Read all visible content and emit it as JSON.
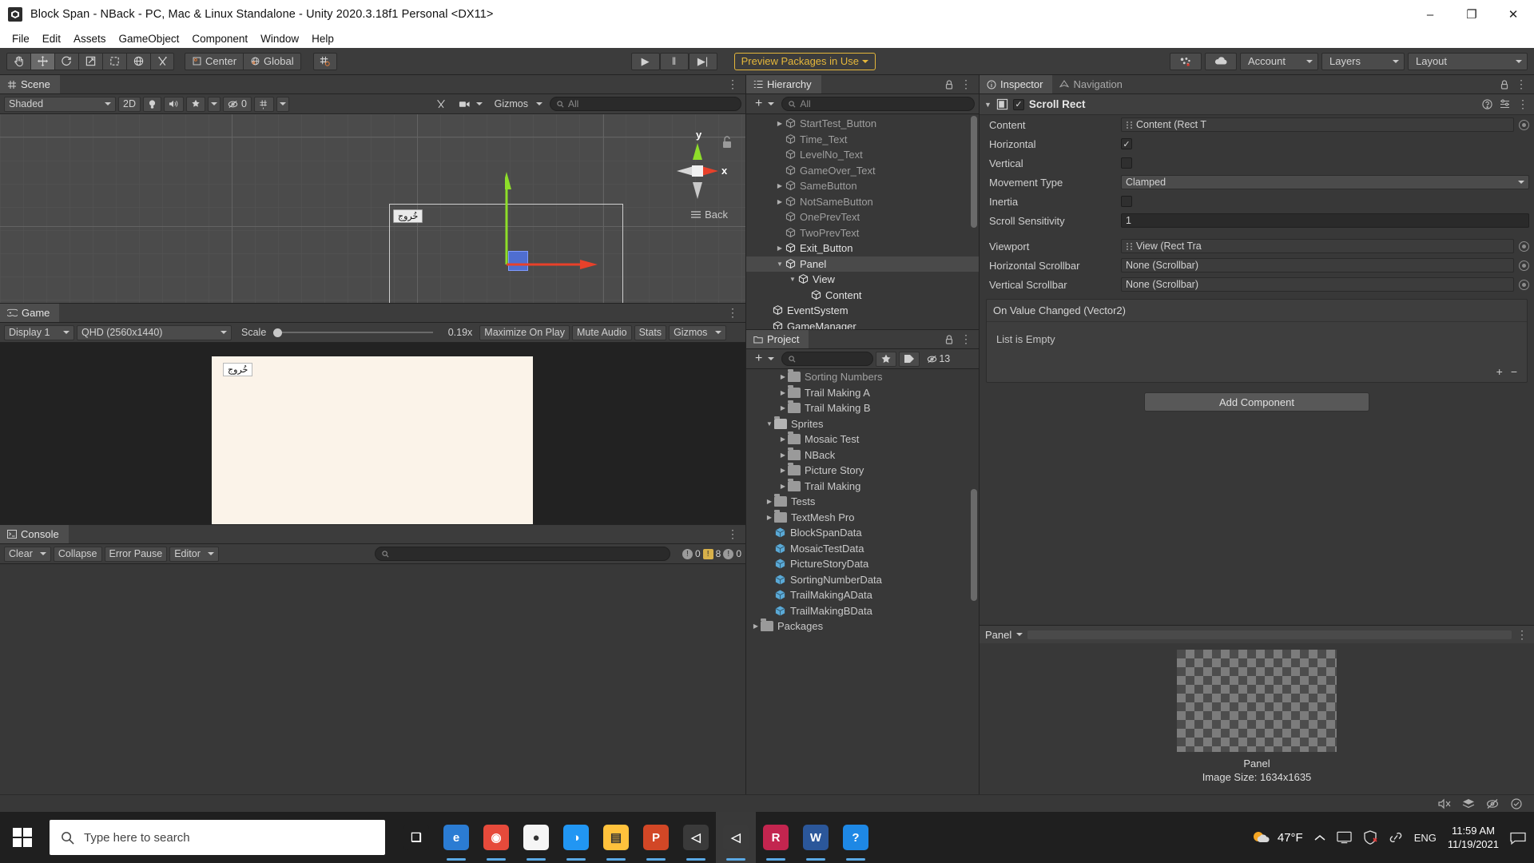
{
  "window": {
    "title": "Block Span - NBack - PC, Mac & Linux Standalone - Unity 2020.3.18f1 Personal <DX11>",
    "app_icon": "unity-icon",
    "minimize": "–",
    "maximize": "❐",
    "close": "✕"
  },
  "menubar": {
    "items": [
      "File",
      "Edit",
      "Assets",
      "GameObject",
      "Component",
      "Window",
      "Help"
    ]
  },
  "toolbar": {
    "tools": [
      {
        "name": "hand-tool",
        "icon": "hand-icon",
        "active": false
      },
      {
        "name": "move-tool",
        "icon": "move-icon",
        "active": true
      },
      {
        "name": "rotate-tool",
        "icon": "rotate-icon",
        "active": false
      },
      {
        "name": "scale-tool",
        "icon": "scale-icon",
        "active": false
      },
      {
        "name": "rect-tool",
        "icon": "rect-icon",
        "active": false
      },
      {
        "name": "transform-tool",
        "icon": "transform-icon",
        "active": false
      },
      {
        "name": "custom-tool",
        "icon": "wrench-icon",
        "active": false
      }
    ],
    "pivot_mode": "Center",
    "pivot_rotation": "Global",
    "grid_snap": "grid-snap-icon",
    "play": "▶",
    "pause": "‖",
    "step": "▶|",
    "preview_packages": "Preview Packages in Use",
    "collab_icon": "collab-icon",
    "cloud_icon": "cloud-icon",
    "account": "Account",
    "layers": "Layers",
    "layout": "Layout"
  },
  "scene": {
    "tab": "Scene",
    "tab_icon": "grid-icon",
    "draw_mode": "Shaded",
    "mode_2d": "2D",
    "lighting_icon": "light-icon",
    "audio_icon": "audio-icon",
    "fx_icon": "fx-icon",
    "hidden_count": "0",
    "grid_icon": "scene-grid-icon",
    "tools_icon": "scene-tools-icon",
    "camera_icon": "scene-camera-icon",
    "gizmos": "Gizmos",
    "search_placeholder": "All",
    "gizmo_axis_y": "y",
    "gizmo_axis_x": "x",
    "view_label": "Back",
    "object_label": "خُروج"
  },
  "game": {
    "tab": "Game",
    "tab_icon": "game-icon",
    "display": "Display 1",
    "resolution": "QHD (2560x1440)",
    "scale_label": "Scale",
    "scale_value": "0.19x",
    "maximize_on_play": "Maximize On Play",
    "mute_audio": "Mute Audio",
    "stats": "Stats",
    "gizmos": "Gizmos",
    "canvas_label": "خُروج"
  },
  "console": {
    "tab": "Console",
    "tab_icon": "console-icon",
    "clear": "Clear",
    "collapse": "Collapse",
    "error_pause": "Error Pause",
    "editor": "Editor",
    "search_placeholder": "",
    "counts": {
      "log": "0",
      "warning": "8",
      "error": "0"
    }
  },
  "hierarchy": {
    "tab": "Hierarchy",
    "tab_icon": "hierarchy-icon",
    "create_label": "+",
    "search_placeholder": "All",
    "items": [
      {
        "label": "StartTest_Button",
        "indent": 2,
        "expandable": true,
        "bright": false,
        "selected": false
      },
      {
        "label": "Time_Text",
        "indent": 2,
        "expandable": false,
        "bright": false,
        "selected": false
      },
      {
        "label": "LevelNo_Text",
        "indent": 2,
        "expandable": false,
        "bright": false,
        "selected": false
      },
      {
        "label": "GameOver_Text",
        "indent": 2,
        "expandable": false,
        "bright": false,
        "selected": false
      },
      {
        "label": "SameButton",
        "indent": 2,
        "expandable": true,
        "bright": false,
        "selected": false
      },
      {
        "label": "NotSameButton",
        "indent": 2,
        "expandable": true,
        "bright": false,
        "selected": false
      },
      {
        "label": "OnePrevText",
        "indent": 2,
        "expandable": false,
        "bright": false,
        "selected": false
      },
      {
        "label": "TwoPrevText",
        "indent": 2,
        "expandable": false,
        "bright": false,
        "selected": false
      },
      {
        "label": "Exit_Button",
        "indent": 2,
        "expandable": true,
        "bright": true,
        "selected": false
      },
      {
        "label": "Panel",
        "indent": 2,
        "expanded": true,
        "bright": true,
        "selected": true
      },
      {
        "label": "View",
        "indent": 3,
        "expanded": true,
        "bright": true,
        "selected": false
      },
      {
        "label": "Content",
        "indent": 4,
        "expandable": false,
        "bright": true,
        "selected": false
      },
      {
        "label": "EventSystem",
        "indent": 1,
        "expandable": false,
        "bright": true,
        "selected": false
      },
      {
        "label": "GameManager",
        "indent": 1,
        "expandable": false,
        "bright": true,
        "selected": false
      }
    ]
  },
  "project": {
    "tab": "Project",
    "tab_icon": "project-icon",
    "create_label": "+",
    "search_placeholder": "",
    "badge_count": "13",
    "items": [
      {
        "label": "Sorting Numbers",
        "indent": 2,
        "type": "folder",
        "expandable": true,
        "dim": true
      },
      {
        "label": "Trail Making A",
        "indent": 2,
        "type": "folder",
        "expandable": true,
        "dim": false
      },
      {
        "label": "Trail Making B",
        "indent": 2,
        "type": "folder",
        "expandable": true,
        "dim": false
      },
      {
        "label": "Sprites",
        "indent": 1,
        "type": "folder-open",
        "expanded": true,
        "dim": false
      },
      {
        "label": "Mosaic Test",
        "indent": 2,
        "type": "folder",
        "expandable": true,
        "dim": false
      },
      {
        "label": "NBack",
        "indent": 2,
        "type": "folder",
        "expandable": true,
        "dim": false
      },
      {
        "label": "Picture Story",
        "indent": 2,
        "type": "folder",
        "expandable": true,
        "dim": false
      },
      {
        "label": "Trail Making",
        "indent": 2,
        "type": "folder",
        "expandable": true,
        "dim": false
      },
      {
        "label": "Tests",
        "indent": 1,
        "type": "folder",
        "expandable": true,
        "dim": false
      },
      {
        "label": "TextMesh Pro",
        "indent": 1,
        "type": "folder",
        "expandable": true,
        "dim": false
      },
      {
        "label": "BlockSpanData",
        "indent": 1,
        "type": "asset",
        "expandable": false,
        "dim": false
      },
      {
        "label": "MosaicTestData",
        "indent": 1,
        "type": "asset",
        "expandable": false,
        "dim": false
      },
      {
        "label": "PictureStoryData",
        "indent": 1,
        "type": "asset",
        "expandable": false,
        "dim": false
      },
      {
        "label": "SortingNumberData",
        "indent": 1,
        "type": "asset",
        "expandable": false,
        "dim": false
      },
      {
        "label": "TrailMakingAData",
        "indent": 1,
        "type": "asset",
        "expandable": false,
        "dim": false
      },
      {
        "label": "TrailMakingBData",
        "indent": 1,
        "type": "asset",
        "expandable": false,
        "dim": false
      },
      {
        "label": "Packages",
        "indent": 0,
        "type": "folder",
        "expandable": true,
        "dim": false
      }
    ]
  },
  "inspector": {
    "tab": "Inspector",
    "tab_icon": "inspector-icon",
    "nav_tab": "Navigation",
    "nav_tab_icon": "navigation-icon",
    "component_title": "Scroll Rect",
    "component_icon": "scrollrect-icon",
    "help_icon": "help-icon",
    "preset_icon": "preset-icon",
    "menu_icon": "kebab-icon",
    "enabled": true,
    "properties": [
      {
        "label": "Content",
        "type": "object",
        "value": "Content (Rect T"
      },
      {
        "label": "Horizontal",
        "type": "checkbox",
        "value": true
      },
      {
        "label": "Vertical",
        "type": "checkbox",
        "value": false
      },
      {
        "label": "Movement Type",
        "type": "dropdown",
        "value": "Clamped"
      },
      {
        "label": "Inertia",
        "type": "checkbox",
        "value": false
      },
      {
        "label": "Scroll Sensitivity",
        "type": "text",
        "value": "1"
      },
      {
        "label": "Viewport",
        "type": "object",
        "value": "View (Rect Tra"
      },
      {
        "label": "Horizontal Scrollbar",
        "type": "object",
        "value": "None (Scrollbar)"
      },
      {
        "label": "Vertical Scrollbar",
        "type": "object",
        "value": "None (Scrollbar)"
      }
    ],
    "event_title": "On Value Changed (Vector2)",
    "event_empty": "List is Empty",
    "event_add": "+",
    "event_remove": "−",
    "add_component": "Add Component",
    "preview_label": "Panel",
    "preview_name": "Panel",
    "preview_size": "Image Size: 1634x1635"
  },
  "taskbar": {
    "search_placeholder": "Type here to search",
    "apps": [
      {
        "name": "task-view-icon",
        "glyph": "❑",
        "color": "#1f1f1f"
      },
      {
        "name": "edge-icon",
        "glyph": "e",
        "color": "#2b7cd3",
        "running": true
      },
      {
        "name": "hotspot-icon",
        "glyph": "◉",
        "color": "#e64a3b",
        "running": true
      },
      {
        "name": "chrome-icon",
        "glyph": "●",
        "color": "#f5f5f5",
        "running": true
      },
      {
        "name": "unity-hub-icon",
        "glyph": "◑",
        "color": "#2196f3",
        "running": true
      },
      {
        "name": "file-explorer-icon",
        "glyph": "▤",
        "color": "#ffc23c",
        "running": true
      },
      {
        "name": "powerpoint-icon",
        "glyph": "P",
        "color": "#d24726",
        "running": true
      },
      {
        "name": "unity-editor-icon",
        "glyph": "◁",
        "color": "#3a3a3a",
        "running": true
      },
      {
        "name": "unity-editor-active-icon",
        "glyph": "◁",
        "color": "#3a3a3a",
        "running": true,
        "active": true
      },
      {
        "name": "rider-icon",
        "glyph": "R",
        "color": "#c3254f",
        "running": true
      },
      {
        "name": "word-icon",
        "glyph": "W",
        "color": "#2b579a",
        "running": true
      },
      {
        "name": "help-icon",
        "glyph": "?",
        "color": "#1e88e5",
        "running": true
      }
    ],
    "weather_temp": "47°F",
    "weather_icon": "sun-cloud-icon",
    "tray": [
      "chevron-up-icon",
      "screen-icon",
      "shield-icon",
      "link-icon"
    ],
    "language": "ENG",
    "time": "11:59 AM",
    "date": "11/19/2021",
    "notification_icon": "notification-icon"
  },
  "status_icons": [
    "mute-icon",
    "layers-icon",
    "eye-off-icon",
    "check-icon"
  ],
  "colors": {
    "accent_yellow": "#e5b73b",
    "panel_bg": "#383838",
    "toolbar_bg": "#3c3c3c",
    "axis_x": "#e8412a",
    "axis_y": "#8ede2a",
    "selection": "#4a4a4a",
    "game_canvas": "#fbf3e9"
  }
}
